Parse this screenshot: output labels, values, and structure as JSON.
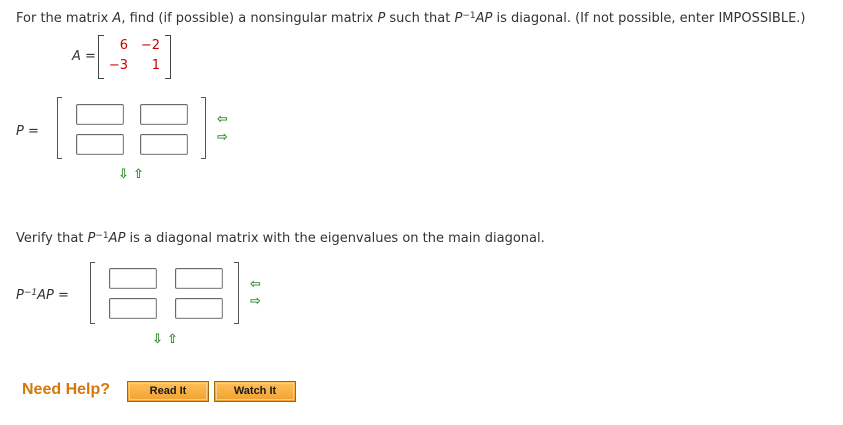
{
  "question": {
    "part1": "For the matrix ",
    "var_a": "A",
    "part2": ", find (if possible) a nonsingular matrix ",
    "var_p": "P",
    "part3": " such that ",
    "expr_p": "P",
    "expr_sup": "−1",
    "expr_ap": "AP",
    "part4": " is diagonal. (If not possible, enter IMPOSSIBLE.)"
  },
  "matrix_a": {
    "label": "A =",
    "r1c1": "6",
    "r1c2": "−2",
    "r2c1": "−3",
    "r2c2": "1"
  },
  "p_matrix": {
    "label": "P ="
  },
  "verify": {
    "part1": "Verify that ",
    "expr_p": "P",
    "expr_sup": "−1",
    "expr_ap": "AP",
    "part2": " is a diagonal matrix with the eigenvalues on the main diagonal."
  },
  "pinv_matrix": {
    "label_p": "P",
    "label_sup": "−1",
    "label_rest": "AP ="
  },
  "icons": {
    "add_col": "⇦",
    "remove_col": "⇨",
    "remove_row": "⇩",
    "add_row": "⇧"
  },
  "help": {
    "title": "Need Help?",
    "read_label": "Read It",
    "watch_label": "Watch It"
  },
  "colors": {
    "matrix_value": "#cc0000",
    "arrow": "#2e8b2e",
    "help_title": "#d7770a",
    "help_button": "#f0a030"
  }
}
